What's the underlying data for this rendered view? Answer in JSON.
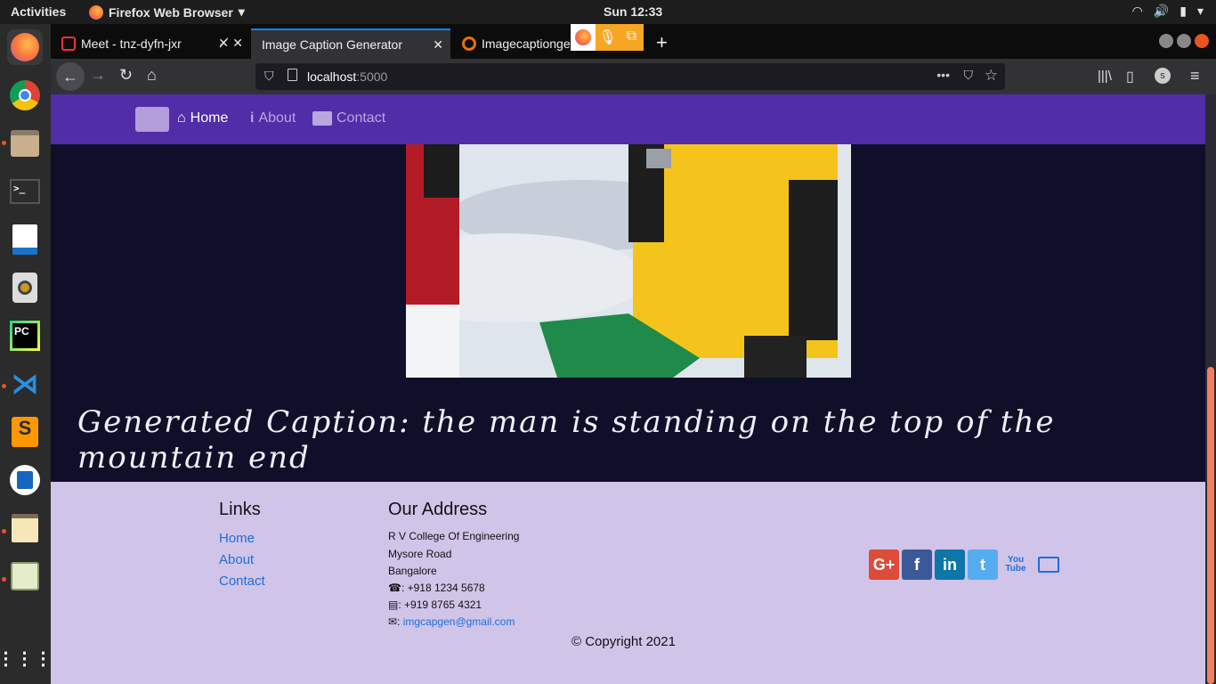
{
  "system": {
    "activities": "Activities",
    "app_name": "Firefox Web Browser",
    "clock": "Sun 12:33"
  },
  "browser": {
    "tabs": [
      {
        "title": "Meet - tnz-dyfn-jxr",
        "active": false
      },
      {
        "title": "Image Caption Generator",
        "active": true
      },
      {
        "title": "Imagecaptionge",
        "active": false
      }
    ],
    "url_host": "localhost",
    "url_port": ":5000"
  },
  "site": {
    "nav": {
      "home": "Home",
      "about": "About",
      "contact": "Contact"
    },
    "caption": "Generated Caption: the man is standing on the top of the mountain end",
    "footer": {
      "links_heading": "Links",
      "links": [
        "Home",
        "About",
        "Contact"
      ],
      "address_heading": "Our Address",
      "address_lines": [
        "R V College Of Engineering",
        "Mysore Road",
        "Bangalore"
      ],
      "phone": ": +918 1234 5678",
      "fax": ": +919 8765 4321",
      "email_prefix": ":",
      "email": "imgcapgen@gmail.com",
      "social": [
        "G+",
        "f",
        "in",
        "t",
        "You Tube",
        "mail"
      ],
      "copyright": "© Copyright 2021"
    }
  },
  "colors": {
    "site_nav": "#512da8",
    "hero_bg": "#0f0f2a",
    "footer_bg": "#d1c4e9",
    "link": "#1e6fd9"
  }
}
